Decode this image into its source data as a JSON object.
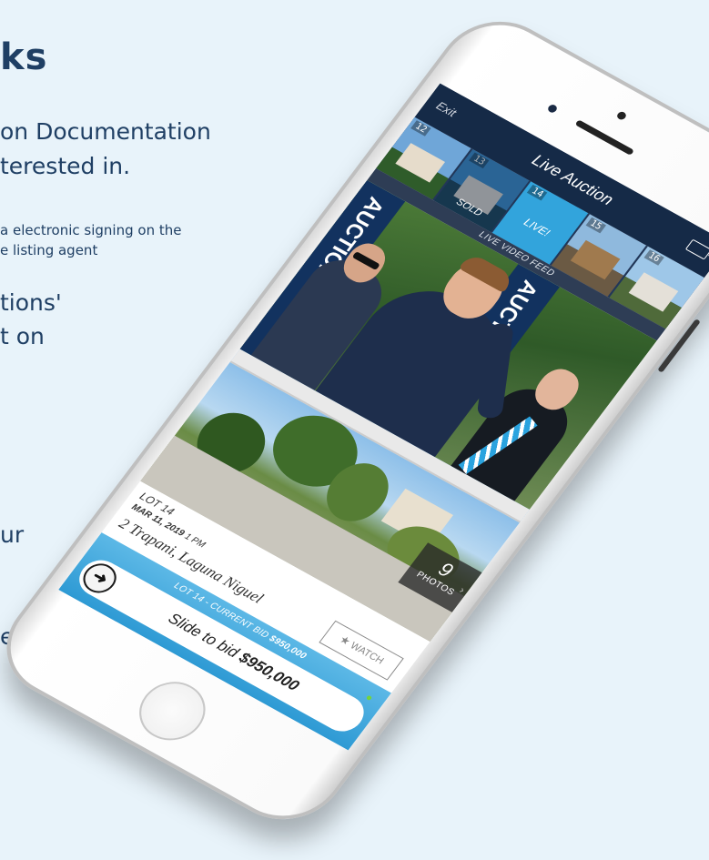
{
  "background_text": {
    "heading": "ks",
    "line1": "on Documentation",
    "line2": "terested in.",
    "small1": "a electronic signing on the",
    "small2": "e listing agent",
    "line3": "tions'",
    "line4": "t on",
    "line5": "ur",
    "line6": "e"
  },
  "app": {
    "exit_label": "Exit",
    "title": "Live Auction",
    "video_icon": "video-camera-icon",
    "feed_label": "LIVE VIDEO FEED",
    "lots": [
      {
        "number": "12",
        "tag": ""
      },
      {
        "number": "13",
        "tag": "SOLD"
      },
      {
        "number": "14",
        "tag": "LIVE!"
      },
      {
        "number": "15",
        "tag": ""
      },
      {
        "number": "16",
        "tag": ""
      }
    ],
    "banner_left": "AUCTION",
    "banner_right": "AUCTION",
    "photos": {
      "count": "9",
      "label": "PHOTOS",
      "chevron": "›"
    },
    "lot_info": {
      "lot": "LOT 14",
      "date": "MAR 11, 2019",
      "time": "1 PM",
      "address": "2 Trapani, Laguna Niguel"
    },
    "watch": {
      "icon": "star-icon",
      "label": "WATCH"
    },
    "bid": {
      "label_prefix": "LOT 14 - CURRENT BID",
      "label_amount": "$950,000",
      "slider_prefix": "Slide to bid",
      "slider_amount": "$950,000",
      "knob_icon": "arrow-right-icon"
    }
  },
  "colors": {
    "navbar": "#152a47",
    "accent": "#32a4dc",
    "background": "#e8f3fa",
    "text": "#1f3f64"
  }
}
